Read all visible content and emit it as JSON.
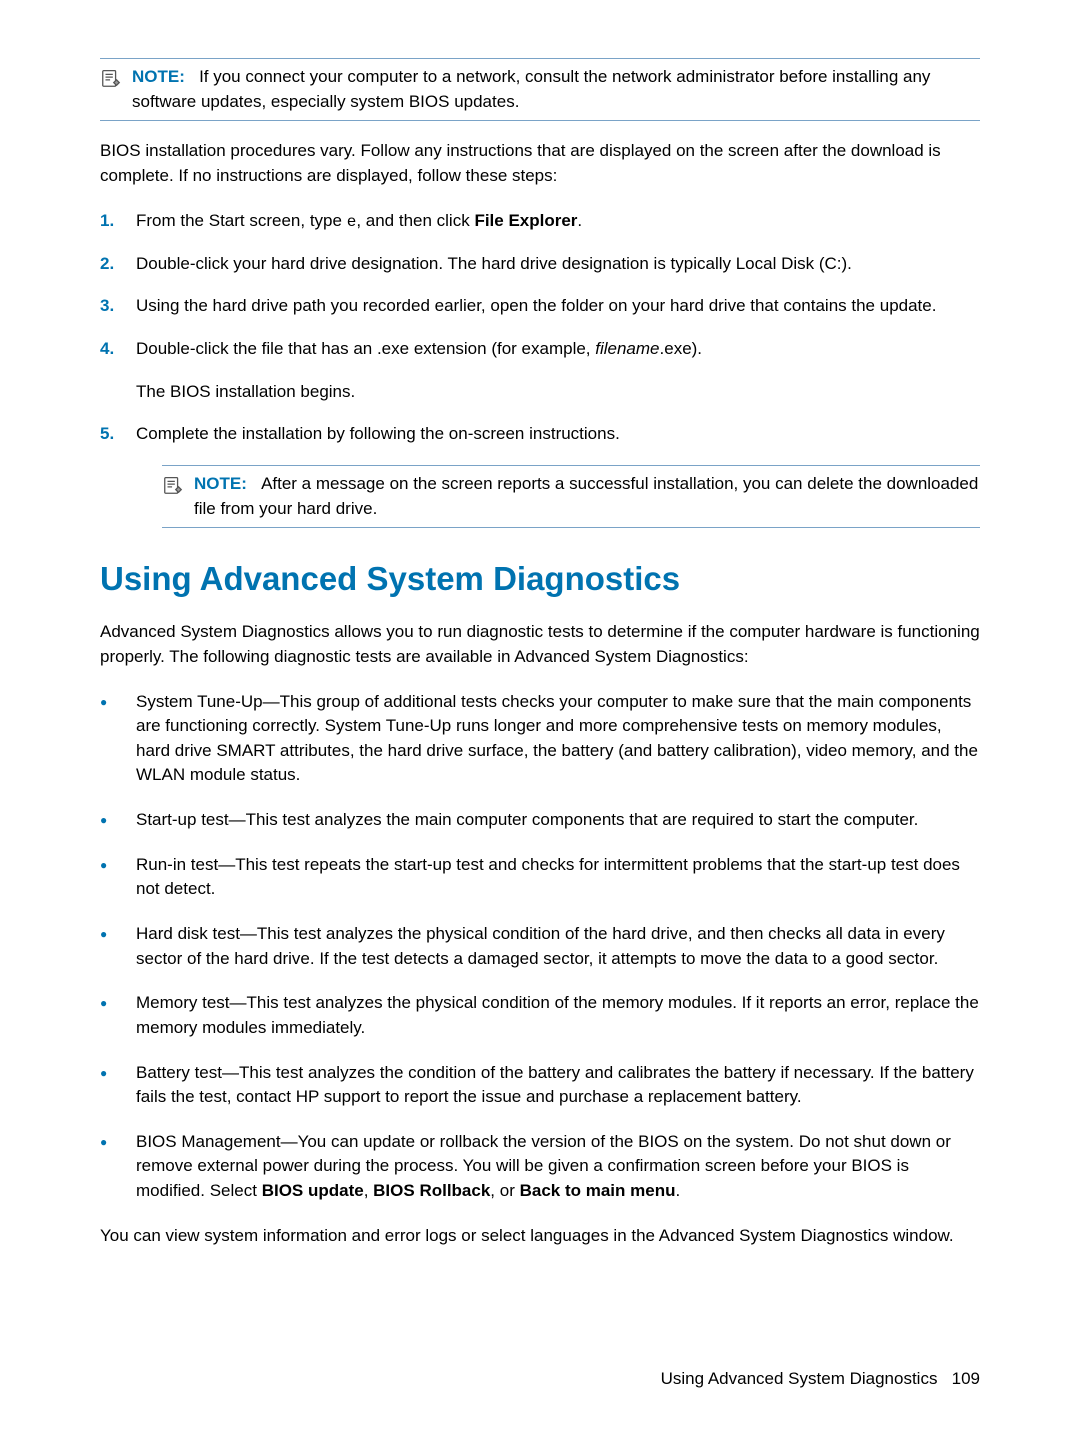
{
  "note1": {
    "label": "NOTE:",
    "text_before": "If you connect your computer to a network, consult the network administrator before installing any software updates, especially system BIOS updates."
  },
  "intro_p": "BIOS installation procedures vary. Follow any instructions that are displayed on the screen after the download is complete. If no instructions are displayed, follow these steps:",
  "steps": [
    {
      "num": "1.",
      "pre": "From the Start screen, type ",
      "code": "e",
      "mid": ", and then click ",
      "bold": "File Explorer",
      "post": "."
    },
    {
      "num": "2.",
      "text": "Double-click your hard drive designation. The hard drive designation is typically Local Disk (C:)."
    },
    {
      "num": "3.",
      "text": "Using the hard drive path you recorded earlier, open the folder on your hard drive that contains the update."
    },
    {
      "num": "4.",
      "pre": "Double-click the file that has an .exe extension (for example, ",
      "italic": "filename",
      "post": ".exe).",
      "sub": "The BIOS installation begins."
    },
    {
      "num": "5.",
      "text": "Complete the installation by following the on-screen instructions."
    }
  ],
  "note2": {
    "label": "NOTE:",
    "text": "After a message on the screen reports a successful installation, you can delete the downloaded file from your hard drive."
  },
  "section_title": "Using Advanced System Diagnostics",
  "section_intro": "Advanced System Diagnostics allows you to run diagnostic tests to determine if the computer hardware is functioning properly. The following diagnostic tests are available in Advanced System Diagnostics:",
  "bullets": [
    "System Tune-Up—This group of additional tests checks your computer to make sure that the main components are functioning correctly. System Tune-Up runs longer and more comprehensive tests on memory modules, hard drive SMART attributes, the hard drive surface, the battery (and battery calibration), video memory, and the WLAN module status.",
    "Start-up test—This test analyzes the main computer components that are required to start the computer.",
    "Run-in test—This test repeats the start-up test and checks for intermittent problems that the start-up test does not detect.",
    "Hard disk test—This test analyzes the physical condition of the hard drive, and then checks all data in every sector of the hard drive. If the test detects a damaged sector, it attempts to move the data to a good sector.",
    "Memory test—This test analyzes the physical condition of the memory modules. If it reports an error, replace the memory modules immediately.",
    "Battery test—This test analyzes the condition of the battery and calibrates the battery if necessary. If the battery fails the test, contact HP support to report the issue and purchase a replacement battery."
  ],
  "bullet_bios": {
    "pre": "BIOS Management—You can update or rollback the version of the BIOS on the system. Do not shut down or remove external power during the process. You will be given a confirmation screen before your BIOS is modified. Select ",
    "b1": "BIOS update",
    "s1": ", ",
    "b2": "BIOS Rollback",
    "s2": ", or ",
    "b3": "Back to main menu",
    "post": "."
  },
  "closing_p": "You can view system information and error logs or select languages in the Advanced System Diagnostics window.",
  "footer": {
    "text": "Using Advanced System Diagnostics",
    "page": "109"
  }
}
